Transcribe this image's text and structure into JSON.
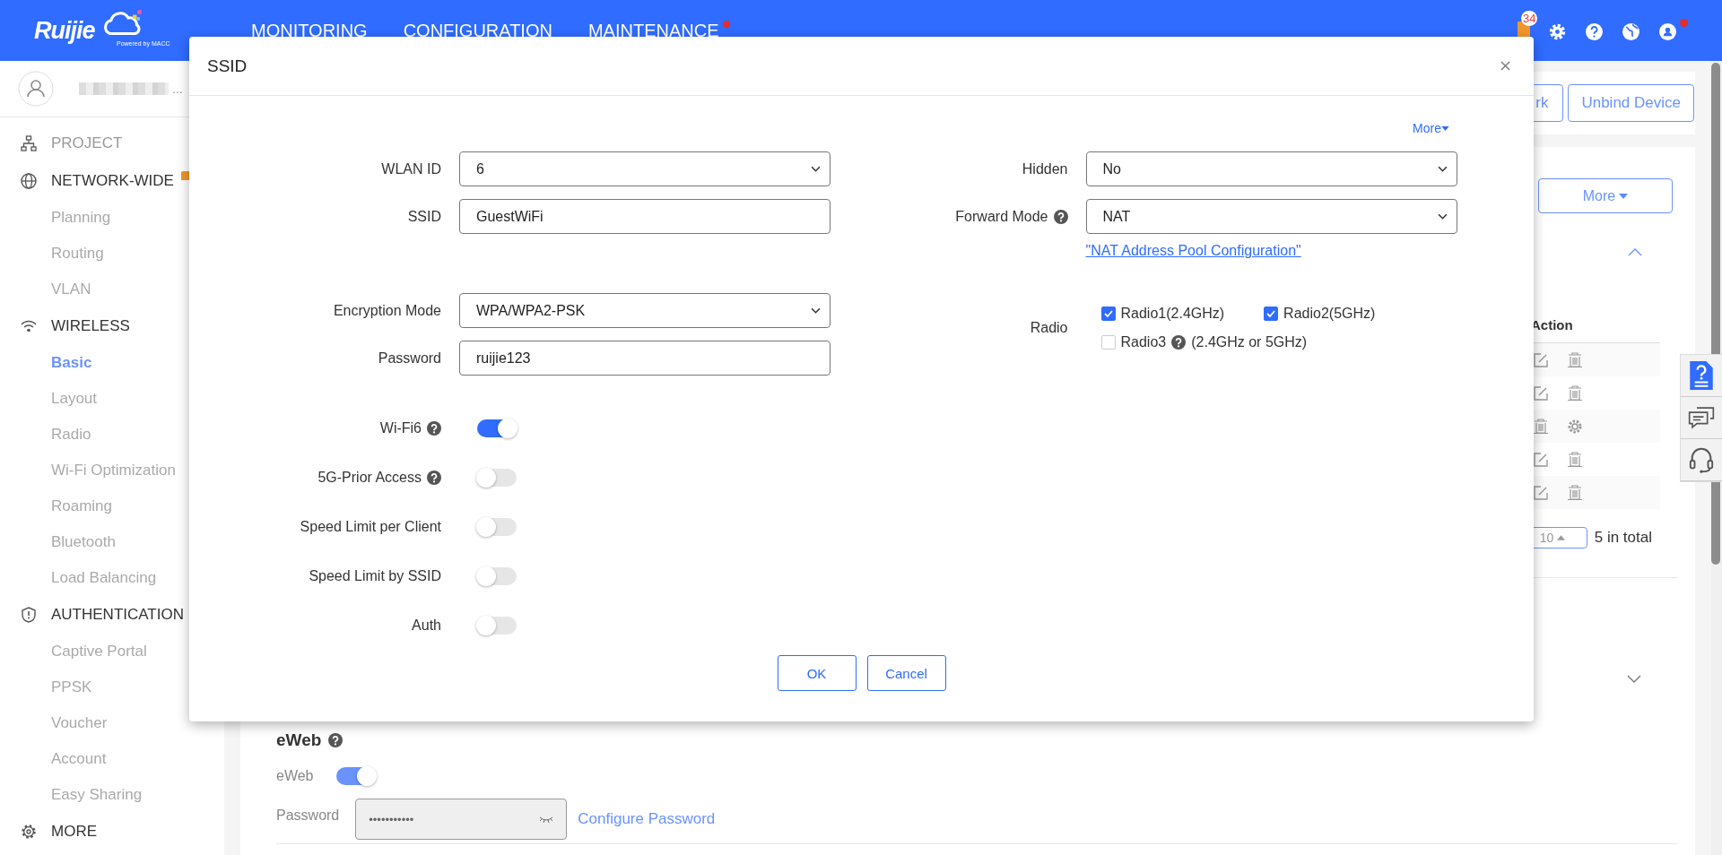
{
  "header": {
    "logo": {
      "name": "Ruijie",
      "tagline": "Powered by MACC"
    },
    "nav": [
      {
        "label": "MONITORING",
        "dot": false
      },
      {
        "label": "CONFIGURATION",
        "dot": false
      },
      {
        "label": "MAINTENANCE",
        "dot": true
      }
    ],
    "notification_count": "34",
    "account_dot": true
  },
  "sidebar": {
    "user_tail": "...",
    "sections": [
      {
        "label": "PROJECT",
        "dimmed": true,
        "badge": false
      },
      {
        "label": "NETWORK-WIDE",
        "dimmed": false,
        "badge": true,
        "children": [
          {
            "label": "Planning",
            "selected": false
          },
          {
            "label": "Routing",
            "selected": false
          },
          {
            "label": "VLAN",
            "selected": false
          }
        ]
      },
      {
        "label": "WIRELESS",
        "dimmed": false,
        "badge": false,
        "children": [
          {
            "label": "Basic",
            "selected": true
          },
          {
            "label": "Layout",
            "selected": false
          },
          {
            "label": "Radio",
            "selected": false
          },
          {
            "label": "Wi-Fi Optimization",
            "selected": false
          },
          {
            "label": "Roaming",
            "selected": false
          },
          {
            "label": "Bluetooth",
            "selected": false
          },
          {
            "label": "Load Balancing",
            "selected": false
          }
        ]
      },
      {
        "label": "AUTHENTICATION",
        "dimmed": false,
        "badge": false,
        "children": [
          {
            "label": "Captive Portal",
            "selected": false
          },
          {
            "label": "PPSK",
            "selected": false
          },
          {
            "label": "Voucher",
            "selected": false
          },
          {
            "label": "Account",
            "selected": false
          },
          {
            "label": "Easy Sharing",
            "selected": false
          }
        ]
      },
      {
        "label": "MORE",
        "dimmed": false,
        "badge": false
      }
    ]
  },
  "page": {
    "toolbar_buttons": [
      "rk",
      "Unbind Device"
    ],
    "more_button": "More",
    "table": {
      "action_header": "Action",
      "rows": [
        {
          "actions": [
            {
              "kind": "edit"
            },
            {
              "kind": "delete"
            }
          ]
        },
        {
          "actions": [
            {
              "kind": "edit"
            },
            {
              "kind": "delete"
            }
          ]
        },
        {
          "actions": [
            {
              "kind": "delete"
            },
            {
              "kind": "settings"
            }
          ]
        },
        {
          "actions": [
            {
              "kind": "edit"
            },
            {
              "kind": "delete"
            }
          ]
        },
        {
          "actions": [
            {
              "kind": "edit"
            },
            {
              "kind": "delete"
            }
          ]
        }
      ]
    },
    "page_size": "10",
    "total": "5 in total",
    "eweb": {
      "title": "eWeb",
      "toggle_label": "eWeb",
      "on": true,
      "password_label": "Password",
      "password_value": "•••••••••••",
      "link": "Configure Password"
    }
  },
  "modal": {
    "title": "SSID",
    "more_link": "More",
    "left_groups": [
      [
        {
          "label": "WLAN ID",
          "kind": "select",
          "value": "6",
          "help": false
        },
        {
          "label": "SSID",
          "kind": "input",
          "value": "GuestWiFi",
          "help": false
        }
      ],
      [
        {
          "label": "Encryption Mode",
          "kind": "select",
          "value": "WPA/WPA2-PSK",
          "help": false
        },
        {
          "label": "Password",
          "kind": "input",
          "value": "ruijie123",
          "help": false
        }
      ]
    ],
    "toggles": [
      {
        "label": "Wi-Fi6",
        "help": true,
        "on": true
      },
      {
        "label": "5G-Prior Access",
        "help": true,
        "on": false
      },
      {
        "label": "Speed Limit per Client",
        "help": false,
        "on": false
      },
      {
        "label": "Speed Limit by SSID",
        "help": false,
        "on": false
      },
      {
        "label": "Auth",
        "help": false,
        "on": false
      }
    ],
    "right_fields": [
      {
        "label": "Hidden",
        "kind": "select",
        "value": "No",
        "help": false
      },
      {
        "label": "Forward Mode",
        "kind": "select",
        "value": "NAT",
        "help": true
      }
    ],
    "pool_link": "\"NAT Address Pool Configuration\"",
    "radio_label": "Radio",
    "radios": [
      {
        "label": "Radio1(2.4GHz)",
        "checked": true,
        "help": false
      },
      {
        "label": "Radio2(5GHz)",
        "checked": true,
        "help": false
      },
      {
        "label": "Radio3",
        "note": "(2.4GHz or 5GHz)",
        "checked": false,
        "help": true
      }
    ],
    "buttons": [
      "OK",
      "Cancel"
    ]
  }
}
